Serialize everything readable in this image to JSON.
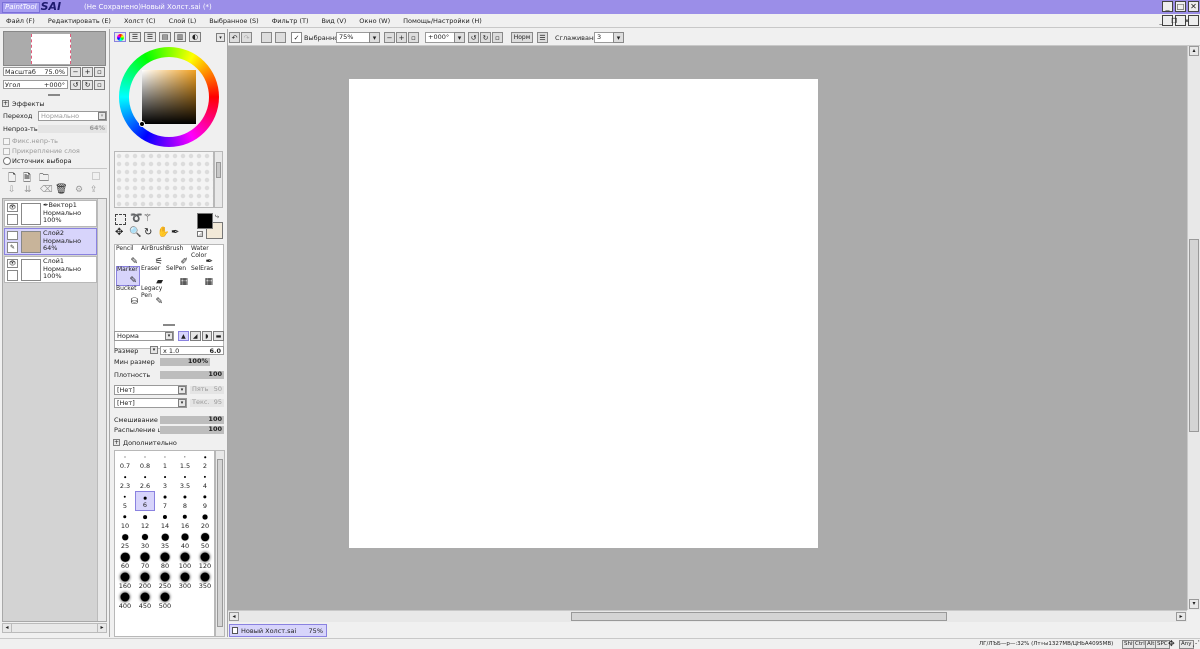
{
  "titlebar": {
    "logo_small": "PaintTool",
    "logo_big": "SAI",
    "title": "(Не Сохранено)Новый Холст.sai (*)",
    "bg": "#9b8ee8"
  },
  "menu": [
    "Файл (F)",
    "Редактировать (E)",
    "Холст (C)",
    "Слой (L)",
    "Выбранное (S)",
    "Фильтр (T)",
    "Вид (V)",
    "Окно (W)",
    "Помощь/Настройки (H)"
  ],
  "navigator": {
    "zoom_label": "Масштаб",
    "zoom_value": "75.0%",
    "angle_label": "Угол",
    "angle_value": "+000°"
  },
  "layer_props": {
    "effects": "Эффекты",
    "blend_label": "Переход",
    "blend_value": "Нормально",
    "opacity_label": "Непроз-ть",
    "opacity_value": "64%",
    "protect_opacity": "Фикс.непр-ть",
    "clipping": "Прикрепление слоя",
    "selection_source": "Источник выбора"
  },
  "layers": [
    {
      "name": "Вектор1",
      "mode": "Нормально",
      "opacity": "100%"
    },
    {
      "name": "Слой2",
      "mode": "Нормально",
      "opacity": "64%"
    },
    {
      "name": "Слой1",
      "mode": "Нормально",
      "opacity": "100%"
    }
  ],
  "colors": {
    "foreground": "#000000",
    "background": "#f2e9d8",
    "accent": "#9b8ee8",
    "selection": "#d7d4fb"
  },
  "tools": [
    {
      "line1": "Pencil",
      "line2": "",
      "icon": "pencil-icon",
      "glyph": "✎"
    },
    {
      "line1": "AirBrush",
      "line2": "",
      "icon": "airbrush-icon",
      "glyph": "⚟"
    },
    {
      "line1": "Brush",
      "line2": "",
      "icon": "brush-icon",
      "glyph": "✐"
    },
    {
      "line1": "Water",
      "line2": "Color",
      "icon": "watercolor-icon",
      "glyph": "✒"
    },
    {
      "line1": "Marker",
      "line2": "",
      "icon": "marker-icon",
      "glyph": "✎"
    },
    {
      "line1": "Eraser",
      "line2": "",
      "icon": "eraser-icon",
      "glyph": "▰"
    },
    {
      "line1": "SelPen",
      "line2": "",
      "icon": "selpen-icon",
      "glyph": "▦"
    },
    {
      "line1": "SelEras",
      "line2": "",
      "icon": "seleras-icon",
      "glyph": "▦"
    },
    {
      "line1": "Bucket",
      "line2": "",
      "icon": "bucket-icon",
      "glyph": "⛁"
    },
    {
      "line1": "Legacy",
      "line2": "Pen",
      "icon": "legacy-pen-icon",
      "glyph": "✎"
    }
  ],
  "brush": {
    "mode": "Норма",
    "size_label": "Размер",
    "size_mult": "x 1.0",
    "size_value": "6.0",
    "min_size_label": "Мин размер",
    "min_size_value": "100%",
    "density_label": "Плотность",
    "density_value": "100",
    "shape1": "[Нет]",
    "shape1_hint": "Пять",
    "shape1_val": "50",
    "shape2": "[Нет]",
    "shape2_hint": "Текс.",
    "shape2_val": "95",
    "blend_label": "Смешивание цвет",
    "blend_value": "100",
    "dilution_label": "Распыление цвет",
    "dilution_value": "100",
    "advanced": "Дополнительно",
    "size_presets": [
      "0.7",
      "0.8",
      "1",
      "1.5",
      "2",
      "2.3",
      "2.6",
      "3",
      "3.5",
      "4",
      "5",
      "6",
      "7",
      "8",
      "9",
      "10",
      "12",
      "14",
      "16",
      "20",
      "25",
      "30",
      "35",
      "40",
      "50",
      "60",
      "70",
      "80",
      "100",
      "120",
      "160",
      "200",
      "250",
      "300",
      "350",
      "400",
      "450",
      "500"
    ],
    "selected_preset": "6"
  },
  "toolbar": {
    "selection_label": "Выбранное",
    "zoom": "75%",
    "angle": "+000°",
    "mode": "Норм",
    "stabilizer_label": "Сглаживание",
    "stabilizer_value": "3"
  },
  "doc_tab": {
    "name": "Новый Холст.sai",
    "zoom": "75%"
  },
  "status": {
    "text": "ЛГ/ЛЪБ—р—:32% (Лт»ы1327МВ/ЦНЬА4095МВ)",
    "keys": [
      "Shift",
      "Ctrl",
      "Alt",
      "SPC",
      "Any"
    ]
  }
}
